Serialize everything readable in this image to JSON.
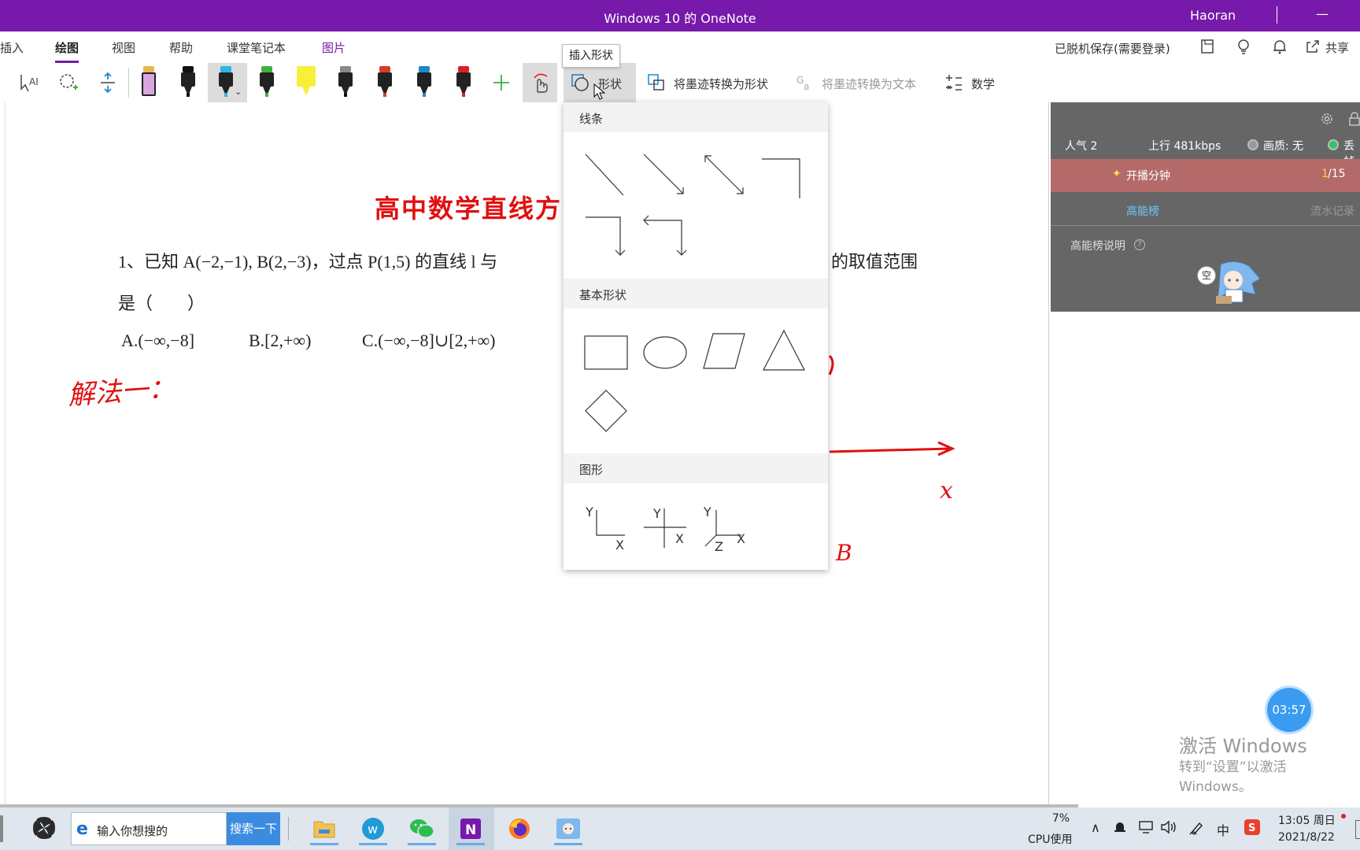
{
  "window": {
    "title": "Windows 10 的 OneNote",
    "user": "Haoran",
    "minimize": "—"
  },
  "menu": {
    "items": [
      {
        "label": "插入"
      },
      {
        "label": "绘图"
      },
      {
        "label": "视图"
      },
      {
        "label": "帮助"
      },
      {
        "label": "课堂笔记本"
      },
      {
        "label": "图片"
      }
    ],
    "save_status": "已脱机保存(需要登录)",
    "share": "共享"
  },
  "toolbar": {
    "shapes_label": "形状",
    "ink_to_shape": "将墨迹转换为形状",
    "ink_to_text": "将墨迹转换为文本",
    "math": "数学",
    "tooltip": "插入形状",
    "pen_colors": [
      "#d9a6e0",
      "#111111",
      "#29b6e8",
      "#3cb043",
      "#f7ef3a",
      "#111111",
      "#d93a2b",
      "#1e88c8",
      "#e02020"
    ]
  },
  "dropdown": {
    "sections": [
      {
        "title": "线条"
      },
      {
        "title": "基本形状"
      },
      {
        "title": "图形"
      }
    ],
    "axis_letters": {
      "y": "Y",
      "x": "X",
      "z": "Z"
    }
  },
  "document": {
    "title": "高中数学直线方",
    "question_line1_a": "1、已知 A(−2,−1), B(2,−3)，过点 P(1,5) 的直线 l 与",
    "question_line1_b": "的取值范围",
    "question_line2": "是（　　）",
    "option_a": "A.(−∞,−8]",
    "option_b": "B.[2,+∞)",
    "option_c": "C.(−∞,−8]∪[2,+∞)",
    "handwritten_method": "解法一：",
    "handwritten_x": "x",
    "handwritten_b": "B"
  },
  "live_panel": {
    "popularity": "人气  2",
    "upload": "上行  481kbps",
    "quality": "画质: 无",
    "extra": "丢帧",
    "broadcast": "开播分钟",
    "page_current": "1",
    "page_total": "/15",
    "tab_active": "高能榜",
    "tab_other": "流水记录",
    "info": "高能榜说明",
    "mascot_text": "空",
    "timer": "03:57"
  },
  "watermark": {
    "line1": "激活 Windows",
    "line2": "转到“设置”以激活 Windows。"
  },
  "taskbar": {
    "search_placeholder": "输入你想搜的",
    "search_button": "搜索一下",
    "cpu_pct": "7%",
    "cpu_label": "CPU使用",
    "ime": "中",
    "time": "13:05 周日",
    "date": "2021/8/22"
  },
  "colors": {
    "accent": "#7719AA",
    "ink_red": "#e01010",
    "panel_gray": "#666666",
    "panel_stripe": "#b56a6a"
  }
}
